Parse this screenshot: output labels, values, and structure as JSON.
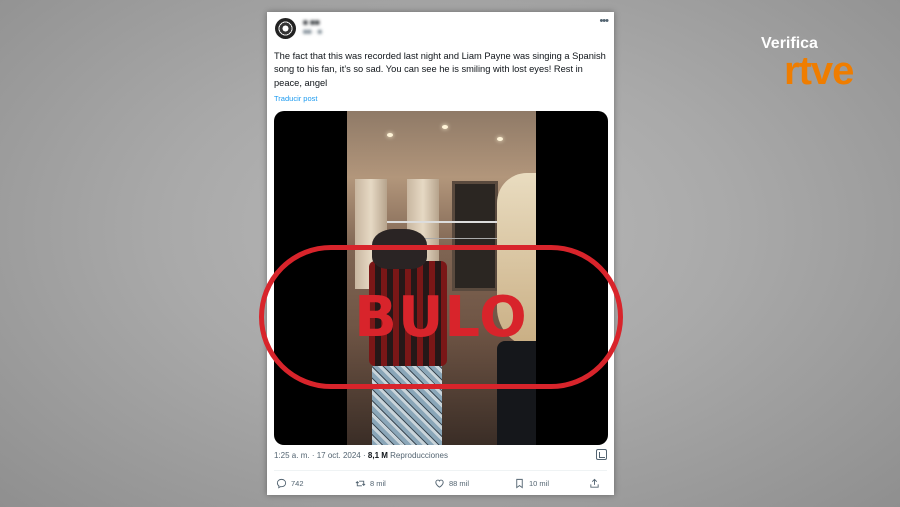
{
  "post": {
    "text": "The fact that this was recorded last night and Liam Payne was singing a Spanish song to his fan, it’s so sad. You can see he is smiling with lost eyes! Rest in peace, angel",
    "translate_label": "Traducir post",
    "time": "1:25 a. m.",
    "separator": "·",
    "date": "17 oct. 2024",
    "views_count": "8,1 M",
    "views_label": "Reproducciones"
  },
  "actions": {
    "replies": "742",
    "reposts": "8 mil",
    "likes": "88 mil",
    "bookmarks": "10 mil"
  },
  "overlay": {
    "stamp_text": "BULO",
    "stamp_color": "#d8242b"
  },
  "brand": {
    "verifica": "Verifica",
    "rtve": "rtve",
    "rtve_color": "#ef7d00"
  },
  "icons": [
    "more-icon",
    "reply-icon",
    "repost-icon",
    "like-icon",
    "bookmark-icon",
    "share-icon",
    "stats-icon"
  ]
}
